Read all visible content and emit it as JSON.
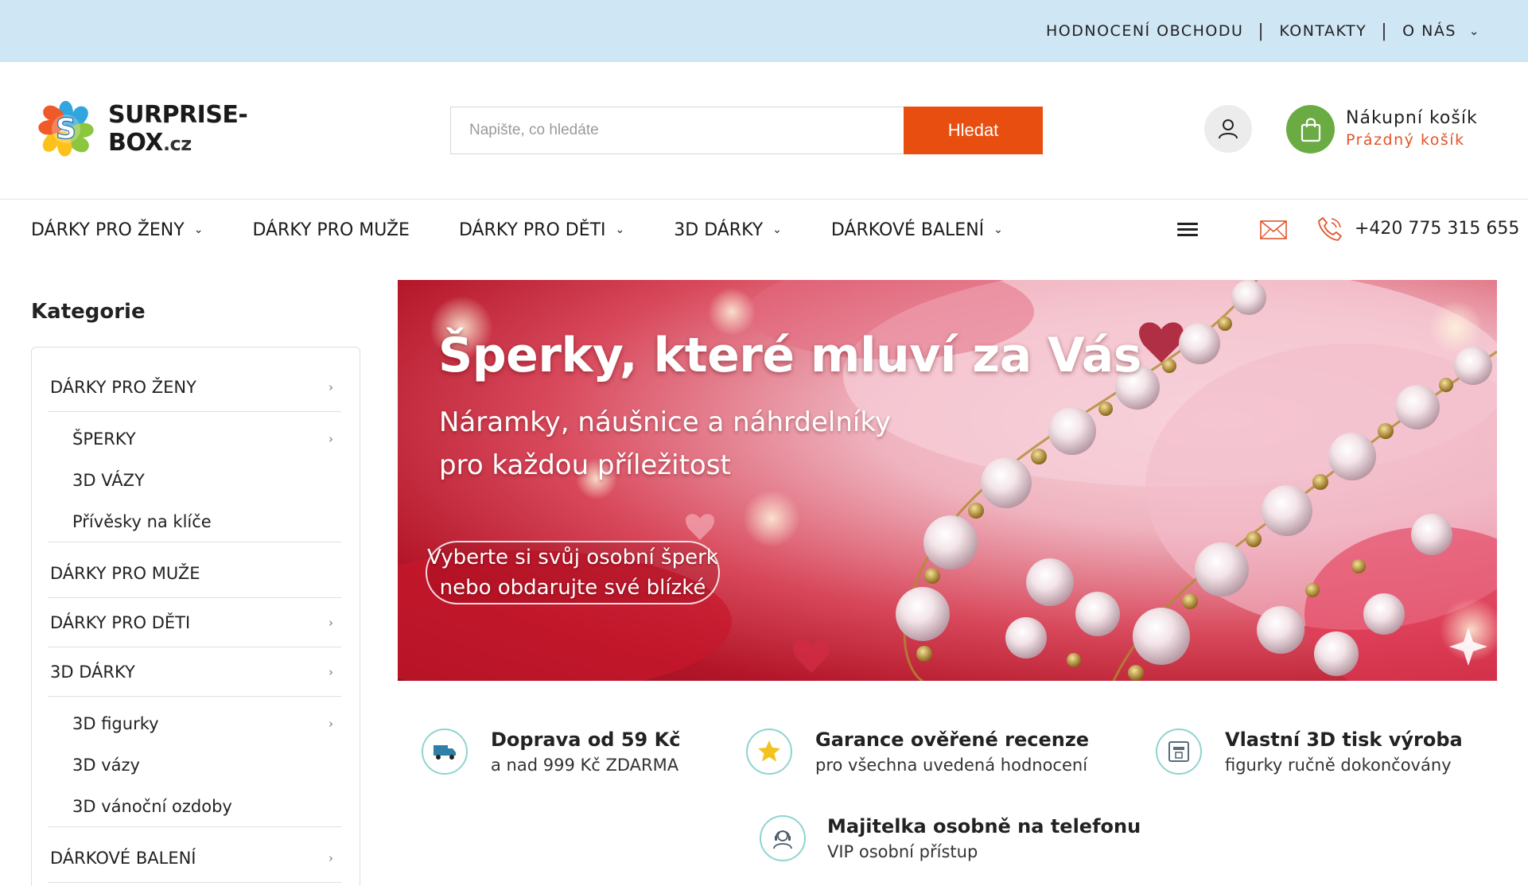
{
  "topbar": {
    "links": [
      "HODNOCENÍ OBCHODU",
      "KONTAKTY",
      "O NÁS"
    ]
  },
  "logo": {
    "name": "SURPRISE-BOX",
    "tld": ".cz"
  },
  "search": {
    "placeholder": "Napište, co hledáte",
    "button_label": "Hledat"
  },
  "cart": {
    "title": "Nákupní košík",
    "status": "Prázdný košík"
  },
  "nav": {
    "items": [
      "DÁRKY PRO ŽENY",
      "DÁRKY PRO MUŽE",
      "DÁRKY PRO DĚTI",
      "3D DÁRKY",
      "DÁRKOVÉ BALENÍ"
    ],
    "phone": "+420 775 315 655"
  },
  "sidebar": {
    "title": "Kategorie",
    "categories": [
      "DÁRKY PRO ŽENY",
      "ŠPERKY",
      "3D VÁZY",
      "Přívěsky na klíče",
      "DÁRKY PRO MUŽE",
      "DÁRKY PRO DĚTI",
      "3D DÁRKY",
      "3D figurky",
      "3D vázy",
      "3D vánoční ozdoby",
      "DÁRKOVÉ BALENÍ"
    ]
  },
  "banner": {
    "title": "Šperky, které mluví za Vás",
    "subtitle_line1": "Náramky, náušnice a náhrdelníky",
    "subtitle_line2": "pro každou příležitost",
    "cta_line1": "Vyberte si svůj osobní šperk",
    "cta_line2": "nebo obdarujte své blízké"
  },
  "benefits": [
    {
      "title": "Doprava od 59 Kč",
      "desc": "a nad 999 Kč ZDARMA",
      "icon": "delivery-truck-icon"
    },
    {
      "title": "Garance ověřené recenze",
      "desc": "pro všechna uvedená hodnocení",
      "icon": "star-rating-icon"
    },
    {
      "title": "Vlastní 3D tisk výroba",
      "desc": "figurky ručně dokončovány",
      "icon": "3d-printer-icon"
    },
    {
      "title": "Majitelka osobně na telefonu",
      "desc": "VIP osobní přístup",
      "icon": "support-agent-icon"
    }
  ],
  "colors": {
    "topbar_bg": "#cfe6f5",
    "search_button": "#e84e0f",
    "cart_button": "#6aac43",
    "cart_status": "#e2542a",
    "benefit_icon_ring": "#8fd4cf"
  }
}
